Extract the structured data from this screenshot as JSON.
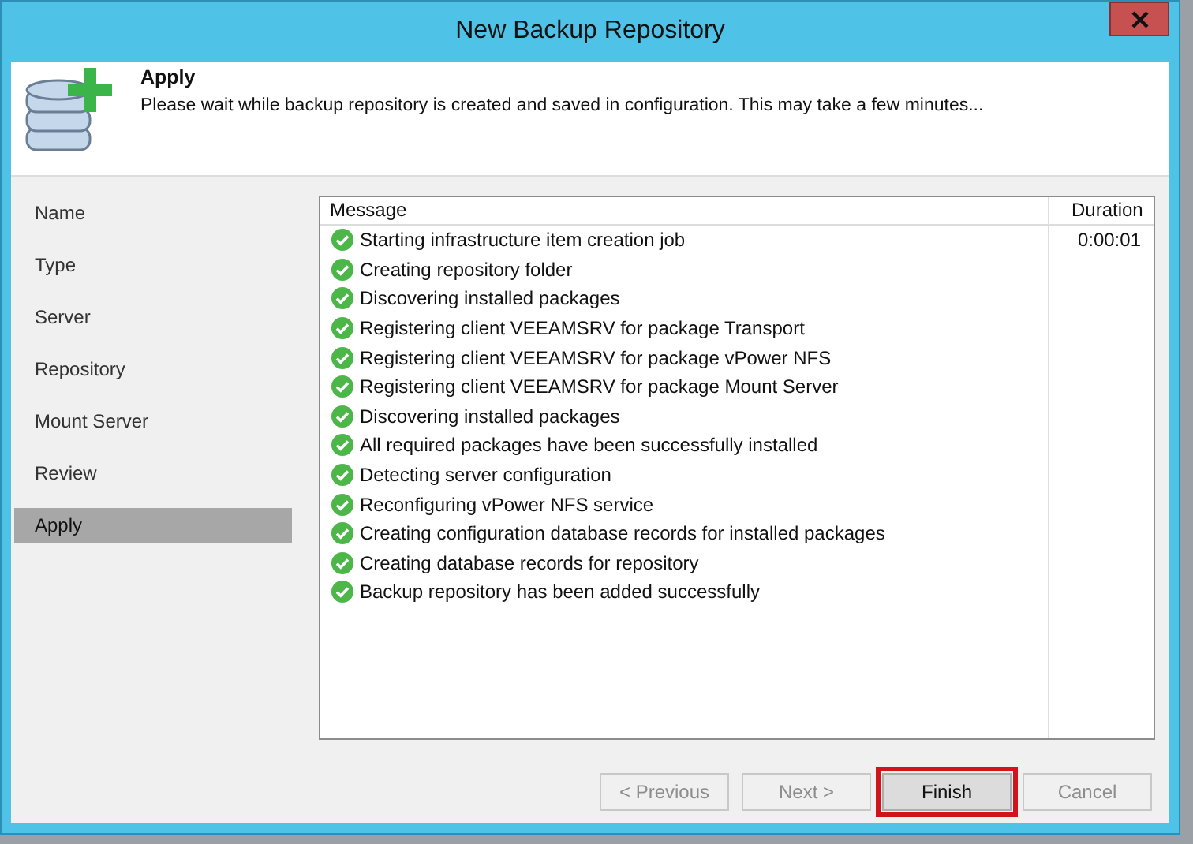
{
  "window": {
    "title": "New Backup Repository"
  },
  "header": {
    "title": "Apply",
    "description": "Please wait while backup repository is created and saved in configuration. This may take a few minutes..."
  },
  "sidebar": {
    "items": [
      {
        "label": "Name",
        "selected": false
      },
      {
        "label": "Type",
        "selected": false
      },
      {
        "label": "Server",
        "selected": false
      },
      {
        "label": "Repository",
        "selected": false
      },
      {
        "label": "Mount Server",
        "selected": false
      },
      {
        "label": "Review",
        "selected": false
      },
      {
        "label": "Apply",
        "selected": true
      }
    ]
  },
  "table": {
    "columns": [
      "Message",
      "Duration"
    ],
    "rows": [
      {
        "message": "Starting infrastructure item creation job",
        "duration": "0:00:01",
        "kind": "success"
      },
      {
        "message": "Creating repository folder",
        "kind": "success"
      },
      {
        "message": "Discovering installed packages",
        "kind": "success"
      },
      {
        "message": "Registering client VEEAMSRV for package Transport",
        "kind": "success"
      },
      {
        "message": "Registering client VEEAMSRV for package vPower NFS",
        "kind": "success"
      },
      {
        "message": "Registering client VEEAMSRV for package Mount Server",
        "kind": "success"
      },
      {
        "message": "Discovering installed packages",
        "kind": "success"
      },
      {
        "message": "All required packages have been successfully installed",
        "kind": "success"
      },
      {
        "message": "Detecting server configuration",
        "kind": "success"
      },
      {
        "message": "Reconfiguring vPower NFS service",
        "kind": "success"
      },
      {
        "message": "Creating configuration database records for installed packages",
        "kind": "success"
      },
      {
        "message": "Creating database records for repository",
        "kind": "success"
      },
      {
        "message": "Backup repository has been added successfully",
        "kind": "success"
      }
    ]
  },
  "buttons": [
    {
      "label": "< Previous",
      "disabled": true,
      "highlighted": false
    },
    {
      "label": "Next >",
      "disabled": true,
      "highlighted": false
    },
    {
      "label": "Finish",
      "disabled": false,
      "highlighted": true
    },
    {
      "label": "Cancel",
      "disabled": true,
      "highlighted": false
    }
  ]
}
